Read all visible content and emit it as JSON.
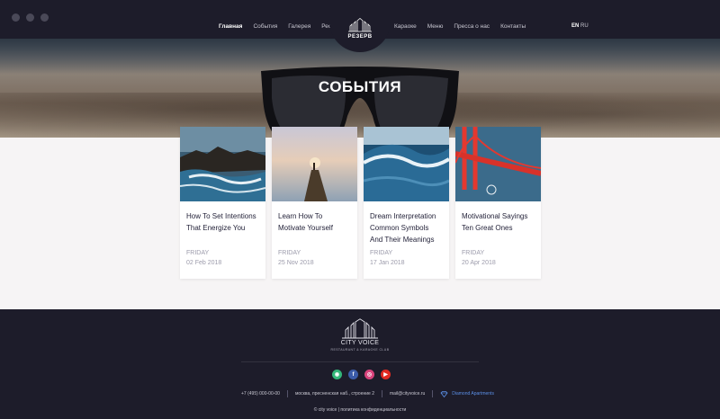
{
  "header": {
    "nav_left": [
      "Главная",
      "События",
      "Галерея",
      "Ресторан"
    ],
    "nav_right": [
      "Караоке",
      "Меню",
      "Пресса о нас",
      "Контакты"
    ],
    "logo_label": "РЕЗЕРВ",
    "lang_current": "EN",
    "lang_other": "RU"
  },
  "hero": {
    "title": "СОБЫТИЯ"
  },
  "cards": [
    {
      "title": "How To Set Intentions That Energize You",
      "day": "FRIDAY",
      "date": "02 Feb 2018"
    },
    {
      "title": "Learn How To Motivate Yourself",
      "day": "FRIDAY",
      "date": "25 Nov 2018"
    },
    {
      "title": "Dream Interpretation Common Symbols And Their Meanings",
      "day": "FRIDAY",
      "date": "17 Jan 2018"
    },
    {
      "title": "Motivational Sayings Ten Great Ones",
      "day": "FRIDAY",
      "date": "20 Apr 2018"
    }
  ],
  "footer": {
    "brand": "CITY VOICE",
    "tagline": "RESTAURANT & KARAOKE CLUB",
    "socials": [
      "tripadvisor-icon",
      "facebook-icon",
      "instagram-icon",
      "youtube-icon"
    ],
    "phone": "+7 (495) 000-00-00",
    "address": "москва, пресненская наб., строение 2",
    "email": "mail@cityvoice.ru",
    "partner": "Diamond Apartments",
    "copyright": "© city voice | политика конфиденциальности"
  },
  "colors": {
    "dark": "#1d1c2a",
    "accent": "#5b8fe6",
    "light_bg": "#f6f4f5"
  }
}
